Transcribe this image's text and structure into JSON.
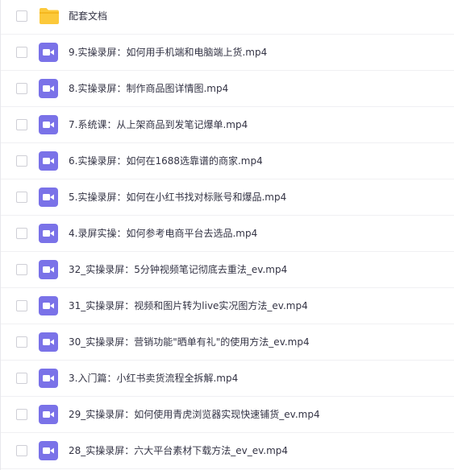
{
  "files": [
    {
      "name": "配套文档",
      "icon": "folder-icon"
    },
    {
      "name": "9.实操录屏：如何用手机端和电脑端上货.mp4",
      "icon": "video-file-icon"
    },
    {
      "name": "8.实操录屏：制作商品图详情图.mp4",
      "icon": "video-file-icon"
    },
    {
      "name": "7.系统课：从上架商品到发笔记爆单.mp4",
      "icon": "video-file-icon"
    },
    {
      "name": "6.实操录屏：如何在1688选靠谱的商家.mp4",
      "icon": "video-file-icon"
    },
    {
      "name": "5.实操录屏：如何在小红书找对标账号和爆品.mp4",
      "icon": "video-file-icon"
    },
    {
      "name": "4.录屏实操：如何参考电商平台去选品.mp4",
      "icon": "video-file-icon"
    },
    {
      "name": "32_实操录屏：5分钟视频笔记彻底去重法_ev.mp4",
      "icon": "video-file-icon"
    },
    {
      "name": "31_实操录屏：视频和图片转为live实况图方法_ev.mp4",
      "icon": "video-file-icon"
    },
    {
      "name": "30_实操录屏：营销功能\"晒单有礼\"的使用方法_ev.mp4",
      "icon": "video-file-icon"
    },
    {
      "name": "3.入门篇：小红书卖货流程全拆解.mp4",
      "icon": "video-file-icon"
    },
    {
      "name": "29_实操录屏：如何使用青虎浏览器实现快速铺货_ev.mp4",
      "icon": "video-file-icon"
    },
    {
      "name": "28_实操录屏：六大平台素材下载方法_ev_ev.mp4",
      "icon": "video-file-icon"
    }
  ],
  "colors": {
    "folder": "#fcc93a",
    "video_icon": "#7a72e8"
  }
}
